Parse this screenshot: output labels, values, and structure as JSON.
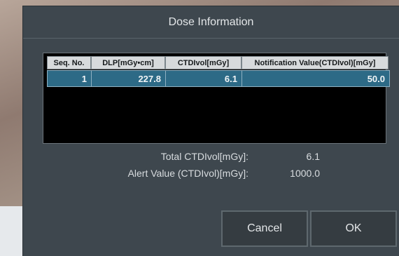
{
  "dialog": {
    "title": "Dose Information"
  },
  "table": {
    "headers": [
      "Seq. No.",
      "DLP[mGy•cm]",
      "CTDIvol[mGy]",
      "Notification Value(CTDIvol)[mGy]"
    ],
    "rows": [
      {
        "seq": "1",
        "dlp": "227.8",
        "ctdivol": "6.1",
        "notification": "50.0"
      }
    ]
  },
  "summary": {
    "total_label": "Total CTDIvol[mGy]:",
    "total_value": "6.1",
    "alert_label": "Alert Value (CTDIvol)[mGy]:",
    "alert_value": "1000.0"
  },
  "buttons": {
    "cancel": "Cancel",
    "ok": "OK"
  },
  "colors": {
    "dialog_bg": "#3e474e",
    "selected_row": "#2d6a86",
    "header_bg": "#d7dadc"
  }
}
